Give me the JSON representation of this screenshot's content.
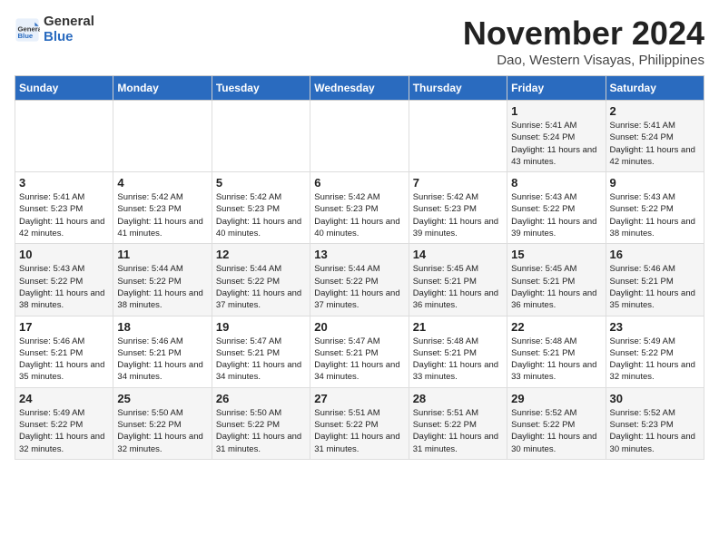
{
  "header": {
    "logo_line1": "General",
    "logo_line2": "Blue",
    "title": "November 2024",
    "subtitle": "Dao, Western Visayas, Philippines"
  },
  "weekdays": [
    "Sunday",
    "Monday",
    "Tuesday",
    "Wednesday",
    "Thursday",
    "Friday",
    "Saturday"
  ],
  "weeks": [
    [
      {
        "day": "",
        "info": ""
      },
      {
        "day": "",
        "info": ""
      },
      {
        "day": "",
        "info": ""
      },
      {
        "day": "",
        "info": ""
      },
      {
        "day": "",
        "info": ""
      },
      {
        "day": "1",
        "info": "Sunrise: 5:41 AM\nSunset: 5:24 PM\nDaylight: 11 hours and 43 minutes."
      },
      {
        "day": "2",
        "info": "Sunrise: 5:41 AM\nSunset: 5:24 PM\nDaylight: 11 hours and 42 minutes."
      }
    ],
    [
      {
        "day": "3",
        "info": "Sunrise: 5:41 AM\nSunset: 5:23 PM\nDaylight: 11 hours and 42 minutes."
      },
      {
        "day": "4",
        "info": "Sunrise: 5:42 AM\nSunset: 5:23 PM\nDaylight: 11 hours and 41 minutes."
      },
      {
        "day": "5",
        "info": "Sunrise: 5:42 AM\nSunset: 5:23 PM\nDaylight: 11 hours and 40 minutes."
      },
      {
        "day": "6",
        "info": "Sunrise: 5:42 AM\nSunset: 5:23 PM\nDaylight: 11 hours and 40 minutes."
      },
      {
        "day": "7",
        "info": "Sunrise: 5:42 AM\nSunset: 5:23 PM\nDaylight: 11 hours and 39 minutes."
      },
      {
        "day": "8",
        "info": "Sunrise: 5:43 AM\nSunset: 5:22 PM\nDaylight: 11 hours and 39 minutes."
      },
      {
        "day": "9",
        "info": "Sunrise: 5:43 AM\nSunset: 5:22 PM\nDaylight: 11 hours and 38 minutes."
      }
    ],
    [
      {
        "day": "10",
        "info": "Sunrise: 5:43 AM\nSunset: 5:22 PM\nDaylight: 11 hours and 38 minutes."
      },
      {
        "day": "11",
        "info": "Sunrise: 5:44 AM\nSunset: 5:22 PM\nDaylight: 11 hours and 38 minutes."
      },
      {
        "day": "12",
        "info": "Sunrise: 5:44 AM\nSunset: 5:22 PM\nDaylight: 11 hours and 37 minutes."
      },
      {
        "day": "13",
        "info": "Sunrise: 5:44 AM\nSunset: 5:22 PM\nDaylight: 11 hours and 37 minutes."
      },
      {
        "day": "14",
        "info": "Sunrise: 5:45 AM\nSunset: 5:21 PM\nDaylight: 11 hours and 36 minutes."
      },
      {
        "day": "15",
        "info": "Sunrise: 5:45 AM\nSunset: 5:21 PM\nDaylight: 11 hours and 36 minutes."
      },
      {
        "day": "16",
        "info": "Sunrise: 5:46 AM\nSunset: 5:21 PM\nDaylight: 11 hours and 35 minutes."
      }
    ],
    [
      {
        "day": "17",
        "info": "Sunrise: 5:46 AM\nSunset: 5:21 PM\nDaylight: 11 hours and 35 minutes."
      },
      {
        "day": "18",
        "info": "Sunrise: 5:46 AM\nSunset: 5:21 PM\nDaylight: 11 hours and 34 minutes."
      },
      {
        "day": "19",
        "info": "Sunrise: 5:47 AM\nSunset: 5:21 PM\nDaylight: 11 hours and 34 minutes."
      },
      {
        "day": "20",
        "info": "Sunrise: 5:47 AM\nSunset: 5:21 PM\nDaylight: 11 hours and 34 minutes."
      },
      {
        "day": "21",
        "info": "Sunrise: 5:48 AM\nSunset: 5:21 PM\nDaylight: 11 hours and 33 minutes."
      },
      {
        "day": "22",
        "info": "Sunrise: 5:48 AM\nSunset: 5:21 PM\nDaylight: 11 hours and 33 minutes."
      },
      {
        "day": "23",
        "info": "Sunrise: 5:49 AM\nSunset: 5:22 PM\nDaylight: 11 hours and 32 minutes."
      }
    ],
    [
      {
        "day": "24",
        "info": "Sunrise: 5:49 AM\nSunset: 5:22 PM\nDaylight: 11 hours and 32 minutes."
      },
      {
        "day": "25",
        "info": "Sunrise: 5:50 AM\nSunset: 5:22 PM\nDaylight: 11 hours and 32 minutes."
      },
      {
        "day": "26",
        "info": "Sunrise: 5:50 AM\nSunset: 5:22 PM\nDaylight: 11 hours and 31 minutes."
      },
      {
        "day": "27",
        "info": "Sunrise: 5:51 AM\nSunset: 5:22 PM\nDaylight: 11 hours and 31 minutes."
      },
      {
        "day": "28",
        "info": "Sunrise: 5:51 AM\nSunset: 5:22 PM\nDaylight: 11 hours and 31 minutes."
      },
      {
        "day": "29",
        "info": "Sunrise: 5:52 AM\nSunset: 5:22 PM\nDaylight: 11 hours and 30 minutes."
      },
      {
        "day": "30",
        "info": "Sunrise: 5:52 AM\nSunset: 5:23 PM\nDaylight: 11 hours and 30 minutes."
      }
    ]
  ]
}
